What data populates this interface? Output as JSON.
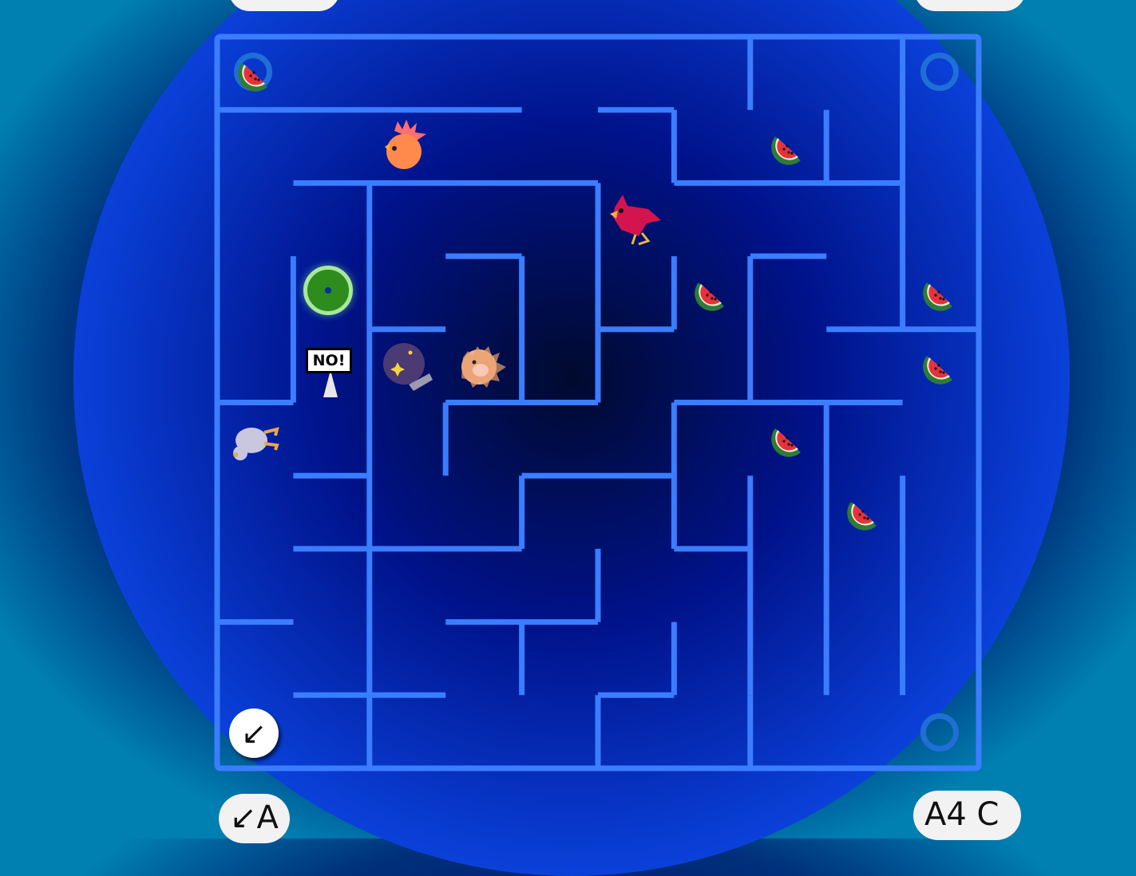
{
  "hud": {
    "bottom_left_label": "↙A",
    "bottom_right_label": "A4  C",
    "cursor_symbol": "↙",
    "sign_text": "NO!"
  },
  "board": {
    "rows": 10,
    "cols": 10,
    "wall_color": "#3a7dff",
    "goal_color": "#2e8b1e"
  },
  "sprites": {
    "player": "green-portal-marker",
    "rooster": "rooster-character",
    "cardinal": "red-bird-enemy",
    "goat": "goat-character",
    "pufferfish": "puffer-character",
    "crystal_ball": "crystal-ball-item"
  },
  "watermelons": [
    {
      "col": 0,
      "row": 0
    },
    {
      "col": 7,
      "row": 1
    },
    {
      "col": 6,
      "row": 3
    },
    {
      "col": 9,
      "row": 3
    },
    {
      "col": 9,
      "row": 4
    },
    {
      "col": 7,
      "row": 5
    },
    {
      "col": 8,
      "row": 6
    }
  ]
}
